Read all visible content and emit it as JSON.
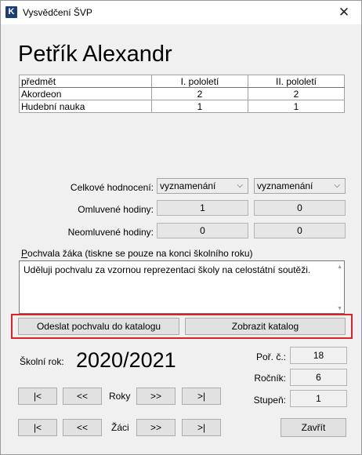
{
  "window": {
    "title": "Vysvědčení ŠVP",
    "app_icon": "K",
    "close_glyph": "✕"
  },
  "student": {
    "name": "Petřík Alexandr"
  },
  "grades": {
    "headers": [
      "předmět",
      "I. pololetí",
      "II. pololetí"
    ],
    "rows": [
      {
        "subject": "Akordeon",
        "h1": "2",
        "h2": "2"
      },
      {
        "subject": "Hudební nauka",
        "h1": "1",
        "h2": "1"
      }
    ]
  },
  "summary": {
    "overall_label": "Celkové hodnocení:",
    "overall_h1": "vyznamenání",
    "overall_h2": "vyznamenání",
    "excused_label": "Omluvené hodiny:",
    "excused_h1": "1",
    "excused_h2": "0",
    "unexcused_label": "Neomluvené hodiny:",
    "unexcused_h1": "0",
    "unexcused_h2": "0"
  },
  "praise": {
    "label_first": "P",
    "label_rest": "ochvala žáka (tiskne se pouze na konci školního roku)",
    "text": "Uděluji pochvalu za vzornou reprezentaci školy na celostátní soutěži.",
    "send_button": "Odeslat pochvalu do katalogu",
    "show_button": "Zobrazit katalog"
  },
  "school_year": {
    "label": "Školní rok:",
    "value": "2020/2021"
  },
  "info": {
    "order_label": "Poř. č.:",
    "order_value": "18",
    "grade_label": "Ročník:",
    "grade_value": "6",
    "level_label": "Stupeň:",
    "level_value": "1"
  },
  "nav": {
    "first": "|<",
    "prev": "<<",
    "next": ">>",
    "last": ">|",
    "years_label": "Roky",
    "students_label": "Žáci"
  },
  "close_button": "Zavřít",
  "icons": {
    "select_chevron": "chevron-down-icon",
    "scroll_up": "scroll-up-arrow-icon",
    "scroll_down": "scroll-down-arrow-icon"
  },
  "colors": {
    "highlight_border": "#d9232a",
    "app_icon_bg": "#1c3f73"
  }
}
